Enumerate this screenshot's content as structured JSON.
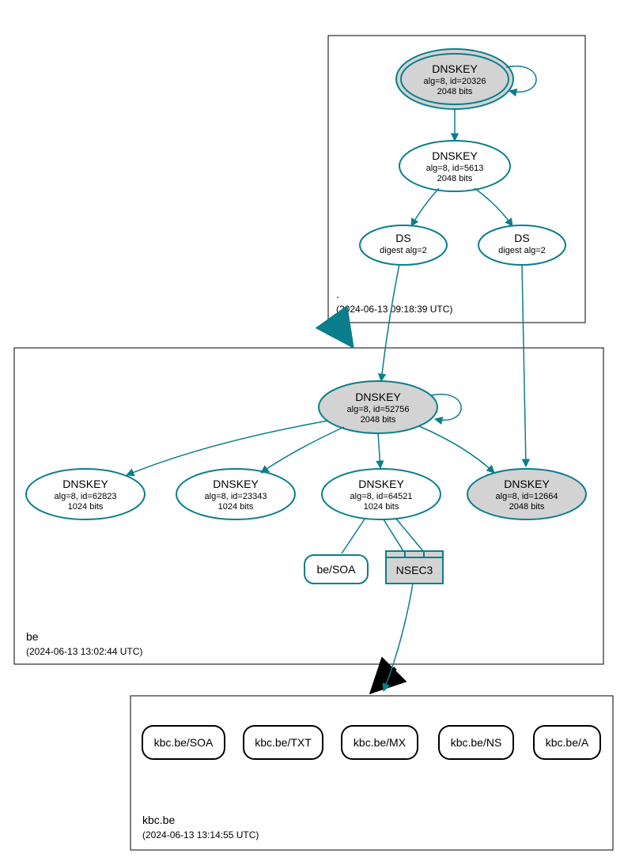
{
  "colors": {
    "teal": "#0a7e8c",
    "grayFill": "#d3d3d3",
    "black": "#000000"
  },
  "zones": {
    "root": {
      "label": ".",
      "timestamp": "(2024-06-13 09:18:39 UTC)"
    },
    "be": {
      "label": "be",
      "timestamp": "(2024-06-13 13:02:44 UTC)"
    },
    "kbc": {
      "label": "kbc.be",
      "timestamp": "(2024-06-13 13:14:55 UTC)"
    }
  },
  "nodes": {
    "root_k1": {
      "title": "DNSKEY",
      "line1": "alg=8, id=20326",
      "line2": "2048 bits"
    },
    "root_k2": {
      "title": "DNSKEY",
      "line1": "alg=8, id=5613",
      "line2": "2048 bits"
    },
    "root_ds1": {
      "title": "DS",
      "line1": "digest alg=2"
    },
    "root_ds2": {
      "title": "DS",
      "line1": "digest alg=2"
    },
    "be_k_52756": {
      "title": "DNSKEY",
      "line1": "alg=8, id=52756",
      "line2": "2048 bits"
    },
    "be_k_62823": {
      "title": "DNSKEY",
      "line1": "alg=8, id=62823",
      "line2": "1024 bits"
    },
    "be_k_23343": {
      "title": "DNSKEY",
      "line1": "alg=8, id=23343",
      "line2": "1024 bits"
    },
    "be_k_64521": {
      "title": "DNSKEY",
      "line1": "alg=8, id=64521",
      "line2": "1024 bits"
    },
    "be_k_12664": {
      "title": "DNSKEY",
      "line1": "alg=8, id=12664",
      "line2": "2048 bits"
    },
    "be_soa": {
      "label": "be/SOA"
    },
    "be_nsec3": {
      "label": "NSEC3"
    },
    "kbc_soa": {
      "label": "kbc.be/SOA"
    },
    "kbc_txt": {
      "label": "kbc.be/TXT"
    },
    "kbc_mx": {
      "label": "kbc.be/MX"
    },
    "kbc_ns": {
      "label": "kbc.be/NS"
    },
    "kbc_a": {
      "label": "kbc.be/A"
    }
  }
}
